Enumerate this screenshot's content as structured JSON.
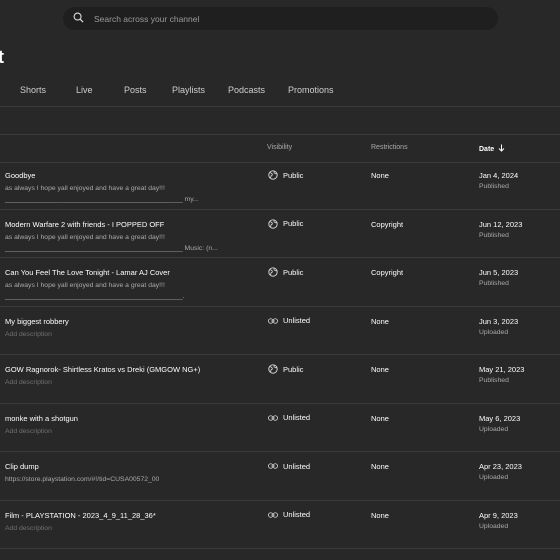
{
  "search": {
    "placeholder": "Search across your channel"
  },
  "page": {
    "title": "t"
  },
  "tabs": [
    {
      "label": "Shorts"
    },
    {
      "label": "Live"
    },
    {
      "label": "Posts"
    },
    {
      "label": "Playlists"
    },
    {
      "label": "Podcasts"
    },
    {
      "label": "Promotions"
    }
  ],
  "columns": {
    "visibility": "Visibility",
    "restrictions": "Restrictions",
    "date": "Date"
  },
  "rows": [
    {
      "title": "Goodbye",
      "desc": "as always I hope yall enjoyed and have a great day!!!\n_______________________________________________ my...",
      "desc_placeholder": false,
      "visibility": "Public",
      "vis_icon": "globe-icon",
      "restrictions": "None",
      "date": "Jan 4, 2024",
      "status": "Published"
    },
    {
      "title": "Modern Warfare 2 with friends - I POPPED OFF",
      "desc": "as always I hope yall enjoyed and have a great day!!!\n_______________________________________________ Music: (n...",
      "desc_placeholder": false,
      "visibility": "Public",
      "vis_icon": "globe-icon",
      "restrictions": "Copyright",
      "date": "Jun 12, 2023",
      "status": "Published"
    },
    {
      "title": "Can You Feel The Love Tonight - Lamar AJ Cover",
      "desc": "as always I hope yall enjoyed and have a great day!!!\n_______________________________________________.",
      "desc_placeholder": false,
      "visibility": "Public",
      "vis_icon": "globe-icon",
      "restrictions": "Copyright",
      "date": "Jun 5, 2023",
      "status": "Published"
    },
    {
      "title": "My biggest robbery",
      "desc": "Add description",
      "desc_placeholder": true,
      "visibility": "Unlisted",
      "vis_icon": "link-icon",
      "restrictions": "None",
      "date": "Jun 3, 2023",
      "status": "Uploaded"
    },
    {
      "title": "GOW Ragnorok- Shirtless Kratos vs Dreki (GMGOW NG+)",
      "desc": "Add description",
      "desc_placeholder": true,
      "visibility": "Public",
      "vis_icon": "globe-icon",
      "restrictions": "None",
      "date": "May 21, 2023",
      "status": "Published"
    },
    {
      "title": "monke with a shotgun",
      "desc": "Add description",
      "desc_placeholder": true,
      "visibility": "Unlisted",
      "vis_icon": "link-icon",
      "restrictions": "None",
      "date": "May 6, 2023",
      "status": "Uploaded"
    },
    {
      "title": "Clip dump",
      "desc": "https://store.playstation.com/#!/tid=CUSA00572_00",
      "desc_placeholder": false,
      "visibility": "Unlisted",
      "vis_icon": "link-icon",
      "restrictions": "None",
      "date": "Apr 23, 2023",
      "status": "Uploaded"
    },
    {
      "title": "Film - PLAYSTATION - 2023_4_9_11_28_36*",
      "desc": "Add description",
      "desc_placeholder": true,
      "visibility": "Unlisted",
      "vis_icon": "link-icon",
      "restrictions": "None",
      "date": "Apr 9, 2023",
      "status": "Uploaded"
    }
  ]
}
